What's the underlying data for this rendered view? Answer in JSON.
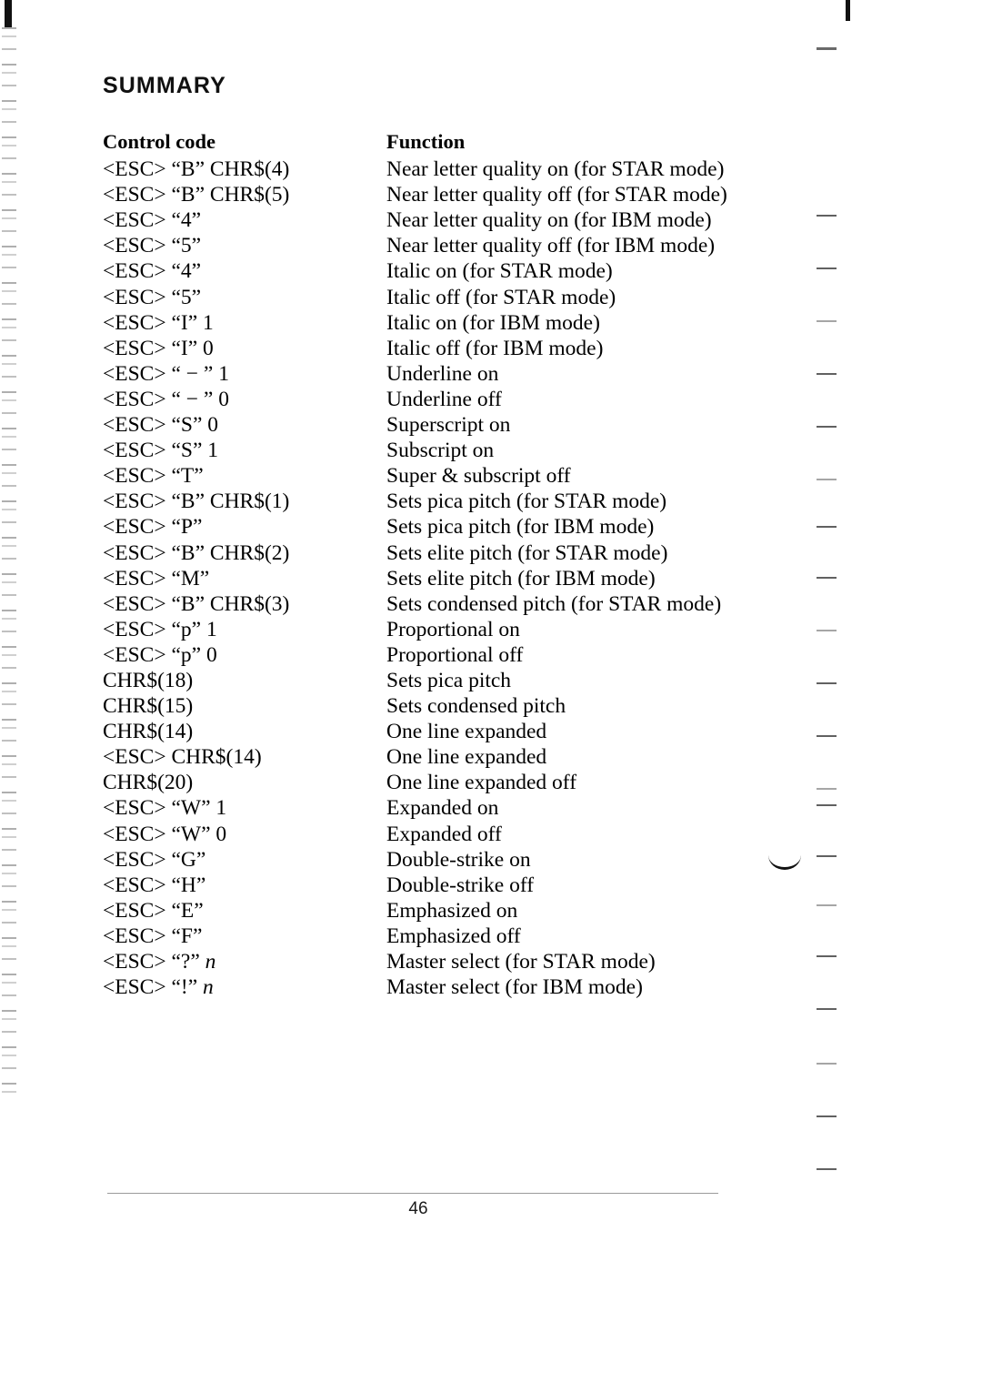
{
  "page": {
    "heading": "SUMMARY",
    "number": "46"
  },
  "table": {
    "headers": {
      "code": "Control code",
      "function": "Function"
    },
    "rows": [
      {
        "code": "<ESC> “B” CHR$(4)",
        "indent": true,
        "function": "Near letter quality on (for STAR mode)"
      },
      {
        "code": "<ESC> “B” CHR$(5)",
        "indent": true,
        "function": "Near letter quality off (for STAR mode)"
      },
      {
        "code": "<ESC> “4”",
        "indent": true,
        "function": "Near letter quality on (for IBM mode)"
      },
      {
        "code": "<ESC> “5”",
        "indent": true,
        "function": "Near letter quality off (for IBM mode)"
      },
      {
        "code": "<ESC> “4”",
        "indent": true,
        "function": "Italic on (for STAR mode)"
      },
      {
        "code": "<ESC> “5”",
        "indent": true,
        "function": "Italic off (for STAR mode)"
      },
      {
        "code": "<ESC> “I” 1",
        "indent": true,
        "function": "Italic on (for IBM mode)"
      },
      {
        "code": "<ESC> “I” 0",
        "indent": true,
        "function": "Italic off (for IBM mode)"
      },
      {
        "code": "<ESC> “ − ” 1",
        "indent": true,
        "function": "Underline on"
      },
      {
        "code": "<ESC> “ − ” 0",
        "indent": true,
        "function": "Underline off"
      },
      {
        "code": "<ESC> “S” 0",
        "indent": true,
        "function": "Superscript on"
      },
      {
        "code": "<ESC> “S” 1",
        "indent": true,
        "function": "Subscript on"
      },
      {
        "code": "<ESC> “T”",
        "indent": true,
        "function": "Super & subscript off"
      },
      {
        "code": "<ESC> “B” CHR$(1)",
        "indent": true,
        "function": "Sets pica pitch (for STAR mode)"
      },
      {
        "code": "<ESC> “P”",
        "indent": true,
        "function": "Sets pica pitch (for IBM mode)"
      },
      {
        "code": "<ESC> “B” CHR$(2)",
        "indent": true,
        "function": "Sets elite pitch (for STAR mode)"
      },
      {
        "code": "<ESC> “M”",
        "indent": true,
        "function": "Sets elite pitch (for IBM mode)"
      },
      {
        "code": "<ESC> “B” CHR$(3)",
        "indent": true,
        "function": "Sets condensed pitch (for STAR mode)"
      },
      {
        "code": "<ESC> “p” 1",
        "indent": true,
        "function": "Proportional on"
      },
      {
        "code": "<ESC> “p” 0",
        "indent": true,
        "function": "Proportional off"
      },
      {
        "code": "CHR$(18)",
        "indent": false,
        "function": "Sets pica pitch"
      },
      {
        "code": "CHR$(15)",
        "indent": false,
        "function": "Sets condensed pitch"
      },
      {
        "code": "CHR$(14)",
        "indent": false,
        "function": "One line expanded"
      },
      {
        "code": "<ESC> CHR$(14)",
        "indent": true,
        "function": "One line expanded"
      },
      {
        "code": "CHR$(20)",
        "indent": false,
        "function": "One line expanded off"
      },
      {
        "code": "<ESC> “W” 1",
        "indent": true,
        "function": "Expanded on"
      },
      {
        "code": "<ESC> “W” 0",
        "indent": true,
        "function": "Expanded off"
      },
      {
        "code": "<ESC> “G”",
        "indent": true,
        "function": "Double-strike on"
      },
      {
        "code": "<ESC> “H”",
        "indent": true,
        "function": "Double-strike off"
      },
      {
        "code": "<ESC> “E”",
        "indent": true,
        "function": "Emphasized on"
      },
      {
        "code": "<ESC> “F”",
        "indent": true,
        "function": "Emphasized off"
      },
      {
        "code": "<ESC> “?” ",
        "param": "n",
        "indent": true,
        "function": "Master select (for STAR mode)"
      },
      {
        "code": "<ESC> “!” ",
        "param": "n",
        "indent": true,
        "function": "Master select (for IBM mode)"
      }
    ]
  },
  "artifacts": {
    "margin_dash_tops": [
      236,
      294,
      352,
      410,
      468,
      526,
      578,
      634,
      692,
      750,
      808,
      866,
      884,
      940,
      994,
      1050,
      1108,
      1168,
      1226,
      1284
    ],
    "margin_dash_left": 898
  }
}
